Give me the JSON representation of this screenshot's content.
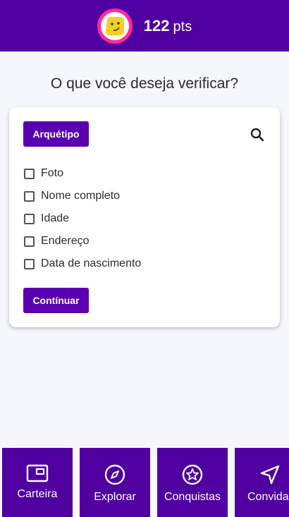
{
  "header": {
    "points": "122",
    "points_unit": "pts",
    "avatar_icon": "smiley-emoji-icon"
  },
  "main": {
    "title": "O que você deseja verificar?",
    "archetype_button": "Arquétipo",
    "options": [
      "Foto",
      "Nome completo",
      "Idade",
      "Endereço",
      "Data de nascimento"
    ],
    "continue_button": "Contínuar"
  },
  "nav": {
    "items": [
      {
        "label": "Carteira",
        "icon": "wallet-icon"
      },
      {
        "label": "Explorar",
        "icon": "compass-icon"
      },
      {
        "label": "Conquistas",
        "icon": "star-badge-icon"
      },
      {
        "label": "Convidar",
        "icon": "send-icon"
      }
    ]
  },
  "colors": {
    "brand": "#5000a0",
    "button": "#5a00b0",
    "avatar_ring": "#ff2a9a"
  }
}
